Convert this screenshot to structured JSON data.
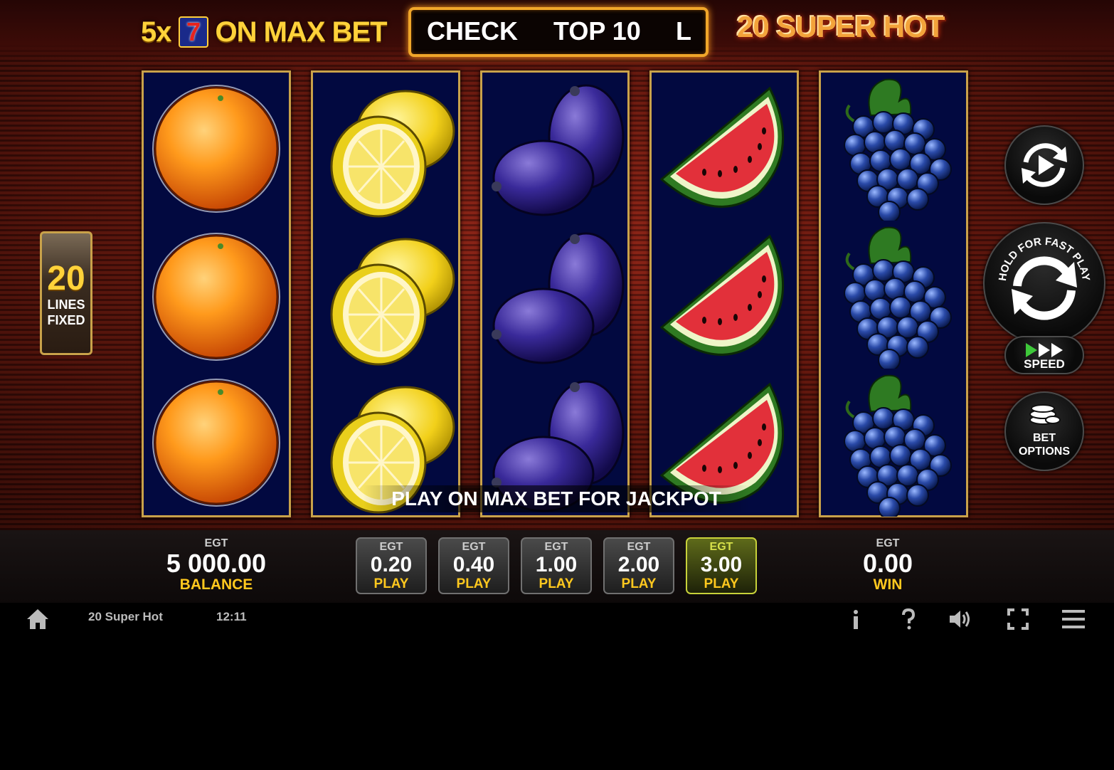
{
  "header": {
    "maxbet_prefix": "5x",
    "seven_symbol": "7",
    "maxbet_suffix": "ON MAX BET",
    "ticker_words": [
      "CHECK",
      "TOP 10",
      "L"
    ],
    "logo": "20 SUPER HOT"
  },
  "lines_panel": {
    "number": "20",
    "line1": "LINES",
    "line2": "FIXED"
  },
  "reels": [
    [
      "orange",
      "orange",
      "orange"
    ],
    [
      "lemon",
      "lemon",
      "lemon"
    ],
    [
      "plum",
      "plum",
      "plum"
    ],
    [
      "watermelon",
      "watermelon",
      "watermelon"
    ],
    [
      "grapes",
      "grapes",
      "grapes"
    ]
  ],
  "jackpot_message": "PLAY ON MAX BET FOR JACKPOT",
  "side_controls": {
    "autoplay_icon": "autoplay-icon",
    "spin_hint": "HOLD FOR FAST PLAY",
    "spin_icon": "spin-icon",
    "speed_label": "SPEED",
    "bet_options_line1": "BET",
    "bet_options_line2": "OPTIONS"
  },
  "balance": {
    "currency": "EGT",
    "value": "5 000.00",
    "label": "BALANCE"
  },
  "bets": [
    {
      "currency": "EGT",
      "value": "0.20",
      "label": "PLAY",
      "selected": false
    },
    {
      "currency": "EGT",
      "value": "0.40",
      "label": "PLAY",
      "selected": false
    },
    {
      "currency": "EGT",
      "value": "1.00",
      "label": "PLAY",
      "selected": false
    },
    {
      "currency": "EGT",
      "value": "2.00",
      "label": "PLAY",
      "selected": false
    },
    {
      "currency": "EGT",
      "value": "3.00",
      "label": "PLAY",
      "selected": true
    }
  ],
  "win": {
    "currency": "EGT",
    "value": "0.00",
    "label": "WIN"
  },
  "system_bar": {
    "game_name": "20 Super Hot",
    "clock": "12:11",
    "icons": [
      "home-icon",
      "info-icon",
      "help-icon",
      "sound-icon",
      "fullscreen-icon",
      "menu-icon"
    ]
  },
  "colors": {
    "gold": "#ffd23a",
    "selected_bet": "#c8d23a",
    "reel_bg": "#020940"
  }
}
